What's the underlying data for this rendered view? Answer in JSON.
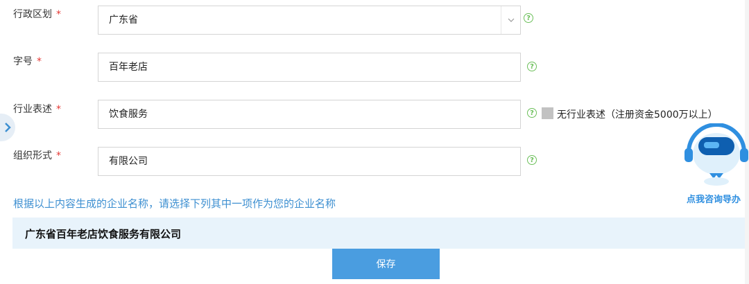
{
  "form": {
    "region": {
      "label": "行政区划",
      "required_mark": "*",
      "value": "广东省"
    },
    "brand": {
      "label": "字号",
      "required_mark": "*",
      "value": "百年老店"
    },
    "industry": {
      "label": "行业表述",
      "required_mark": "*",
      "value": "饮食服务"
    },
    "org_form": {
      "label": "组织形式",
      "required_mark": "*",
      "value": "有限公司"
    },
    "no_industry_option": {
      "label": "无行业表述（注册资金5000万以上）",
      "checked": false
    },
    "help_glyph": "?"
  },
  "hint": "根据以上内容生成的企业名称，请选择下列其中一项作为您的企业名称",
  "generated_names": [
    "广东省百年老店饮食服务有限公司"
  ],
  "save_label": "保存",
  "assistant": {
    "caption": "点我咨询导办"
  },
  "colors": {
    "accent": "#4a9de0",
    "hint_text": "#3d8fd1",
    "required": "#e53935",
    "help": "#6bbf59",
    "result_bg": "#e8f3fb"
  }
}
